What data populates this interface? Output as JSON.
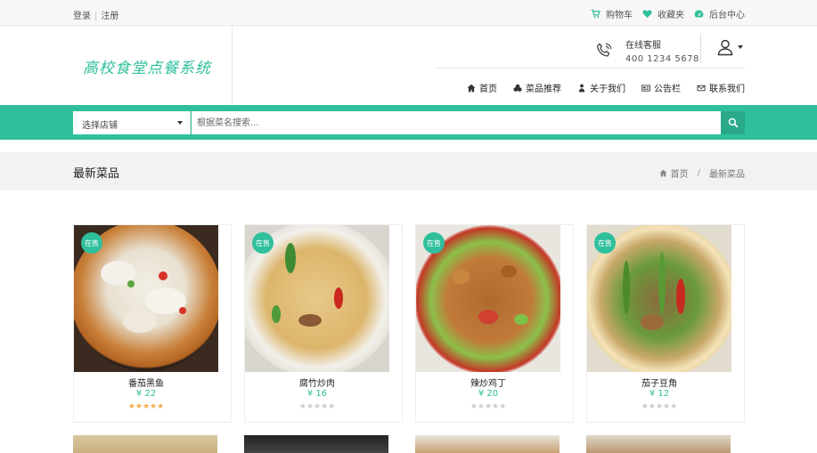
{
  "topbar": {
    "login": "登录",
    "register": "注册",
    "cart": "购物车",
    "favorites": "收藏夹",
    "admin": "后台中心"
  },
  "header": {
    "logo": "高校食堂点餐系统",
    "service_title": "在线客服",
    "service_phone": "400 1234 5678"
  },
  "nav": [
    "首页",
    "菜品推荐",
    "关于我们",
    "公告栏",
    "联系我们"
  ],
  "search": {
    "store_select": "选择店铺",
    "placeholder": "根据菜名搜索..."
  },
  "section": {
    "title": "最新菜品",
    "breadcrumb_home": "首页",
    "breadcrumb_current": "最新菜品"
  },
  "dishes": [
    {
      "badge": "在售",
      "name": "番茄黑鱼",
      "price": "¥ 22",
      "rating": 5
    },
    {
      "badge": "在售",
      "name": "腐竹炒肉",
      "price": "¥ 16",
      "rating": 0
    },
    {
      "badge": "在售",
      "name": "辣炒鸡丁",
      "price": "¥ 20",
      "rating": 0
    },
    {
      "badge": "在售",
      "name": "茄子豆角",
      "price": "¥ 12",
      "rating": 0
    }
  ],
  "colors": {
    "accent": "#2fbf9c",
    "star": "#f0ad4e"
  }
}
